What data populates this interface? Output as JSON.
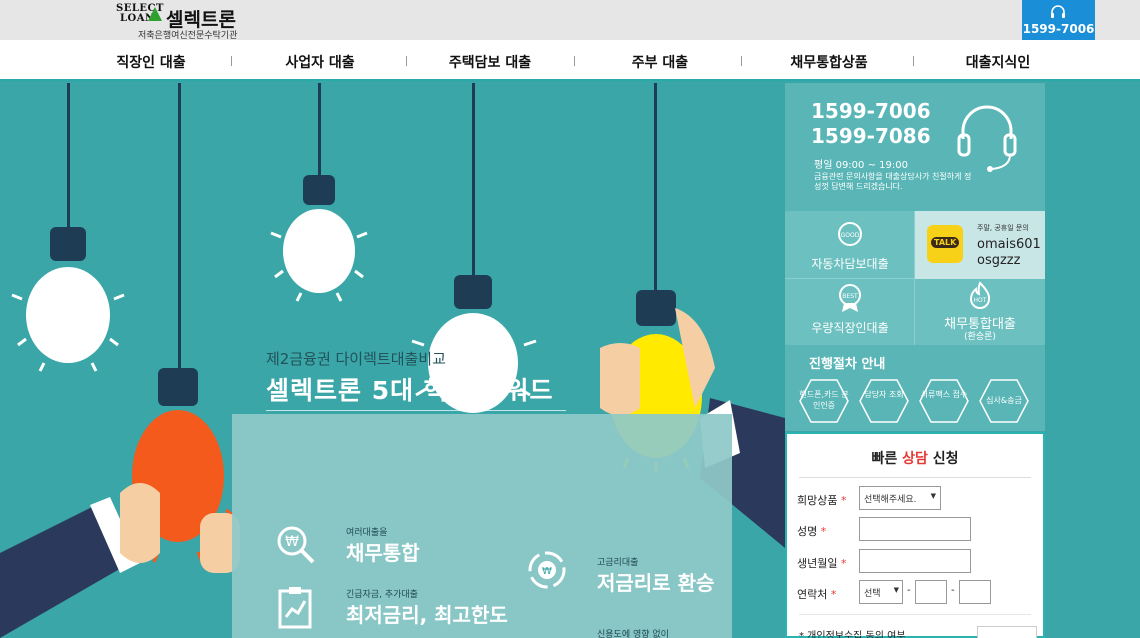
{
  "header": {
    "logo_select": "SELECT",
    "logo_loan": "LOAN",
    "logo_brand": "셀렉트론",
    "logo_sub": "저축은행여신전문수탁기관",
    "phone": "1599-7006",
    "phone_icon": "headset-icon"
  },
  "nav": {
    "items": [
      "직장인 대출",
      "사업자 대출",
      "주택담보 대출",
      "주부 대출",
      "채무통합상품",
      "대출지식인"
    ]
  },
  "hero": {
    "subtitle": "제2금융권 다이렉트대출비교",
    "title": "셀렉트론  5대 핵심 키워드",
    "keywords": [
      {
        "small": "여러대출을",
        "big": "채무통합",
        "icon": "won-search-icon"
      },
      {
        "small": "고금리대출",
        "big": "저금리로 환승",
        "icon": "exchange-won-icon"
      },
      {
        "small": "긴급자금, 추가대출",
        "big": "최저금리, 최고한도",
        "icon": "clipboard-chart-icon"
      },
      {
        "small": "신용도에 영향 없이",
        "big": "",
        "icon": ""
      }
    ]
  },
  "sidebar": {
    "phone1": "1599-7006",
    "phone2": "1599-7086",
    "hours": "평일 09:00 ~ 19:00",
    "desc": "금융관련 문의사항을 대출상담사가 친절하게 정성껏 답변해 드리겠습니다.",
    "products": [
      {
        "badge": "GOOD",
        "label": "자동차담보대출",
        "sublabel": ""
      },
      {
        "badge": "BEST",
        "label": "우량직장인대출",
        "sublabel": ""
      },
      {
        "badge": "HOT",
        "label": "채무통합대출",
        "sublabel": "(환승론)"
      }
    ],
    "kakao": {
      "badge": "TALK",
      "header": "주말, 공휴일 문의",
      "id1": "omais601",
      "id2": "osgzzz"
    },
    "process_title": "진행절차 안내",
    "process_steps": [
      "핸드폰,카드 본인인증",
      "담당자 조회",
      "서류팩스 접수",
      "심사&송금"
    ]
  },
  "form": {
    "title_pre": "빠른 ",
    "title_red": "상담",
    "title_post": " 신청",
    "fields": [
      {
        "label": "희망상품",
        "required": "*"
      },
      {
        "label": "성명",
        "required": "*"
      },
      {
        "label": "생년월일",
        "required": "*"
      },
      {
        "label": "연락처",
        "required": "*"
      }
    ],
    "product_select": "선택해주세요.",
    "phone_select": "선택",
    "dash": "-",
    "consent": "* 개인정보수집 동의 여부"
  },
  "colors": {
    "teal_bg": "#3aa6a7",
    "sidebar": "#5ab6b6",
    "accent_blue": "#1a8fd8",
    "red": "#e53935"
  }
}
